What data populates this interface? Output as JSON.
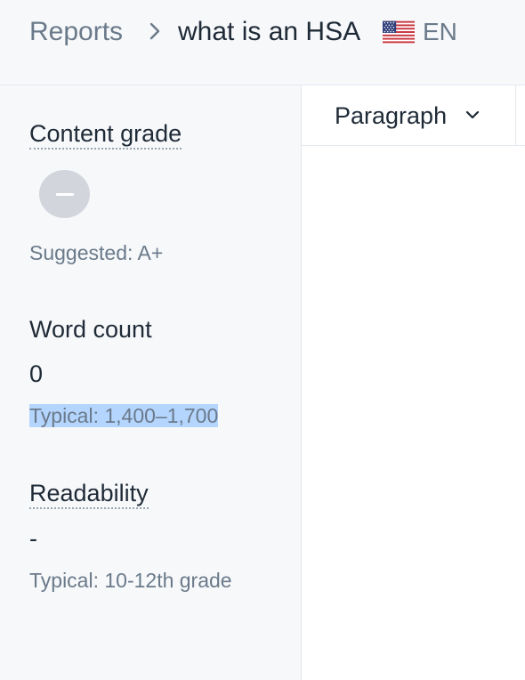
{
  "header": {
    "breadcrumb_root": "Reports",
    "separator_icon": "chevron-right-icon",
    "document_title": "what is an HSA",
    "flag_icon": "us-flag-icon",
    "language": "EN"
  },
  "sidebar": {
    "content_grade": {
      "title": "Content grade",
      "grade_placeholder_icon": "dash-icon",
      "suggested": "Suggested: A+"
    },
    "word_count": {
      "title": "Word count",
      "value": "0",
      "typical": "Typical: 1,400–1,700"
    },
    "readability": {
      "title": "Readability",
      "value": "-",
      "typical": "Typical: 10-12th grade"
    }
  },
  "editor": {
    "block_type": "Paragraph",
    "block_type_icon": "chevron-down-icon"
  },
  "colors": {
    "text": "#1f2a37",
    "muted": "#6b7a8a",
    "highlight": "#b4d5fe",
    "grade_badge": "#d2d6dc"
  }
}
